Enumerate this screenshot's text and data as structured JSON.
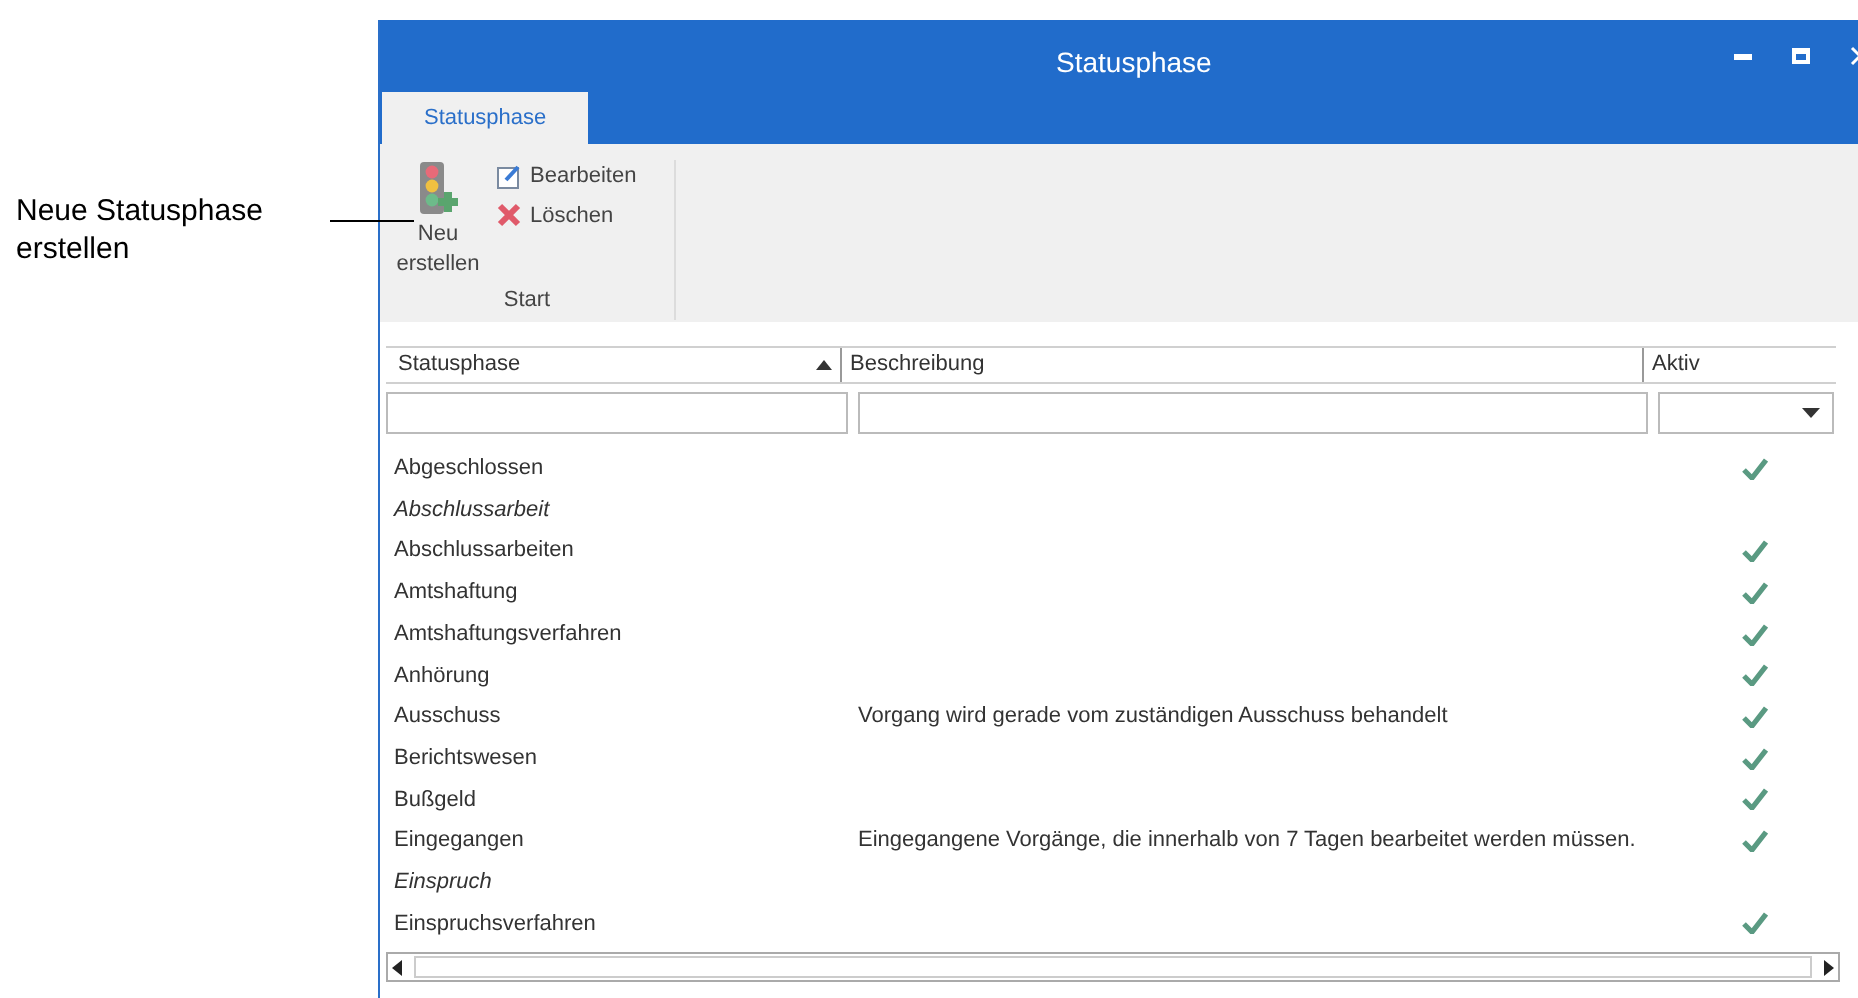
{
  "annotation": {
    "text": "Neue Statusphase erstellen"
  },
  "window": {
    "title": "Statusphase"
  },
  "tabs": [
    {
      "label": "Statusphase",
      "selected": true
    }
  ],
  "ribbon": {
    "new_button": "Neu erstellen",
    "edit_button": "Bearbeiten",
    "delete_button": "Löschen",
    "group_label": "Start"
  },
  "table": {
    "columns": [
      "Statusphase",
      "Beschreibung",
      "Aktiv"
    ],
    "rows": [
      {
        "name": "Abgeschlossen",
        "description": "",
        "active": true
      },
      {
        "name": "Abschlussarbeit",
        "description": "",
        "active": false
      },
      {
        "name": "Abschlussarbeiten",
        "description": "",
        "active": true
      },
      {
        "name": "Amtshaftung",
        "description": "",
        "active": true
      },
      {
        "name": "Amtshaftungsverfahren",
        "description": "",
        "active": true
      },
      {
        "name": "Anhörung",
        "description": "",
        "active": true
      },
      {
        "name": "Ausschuss",
        "description": "Vorgang wird gerade vom zuständigen Ausschuss behandelt",
        "active": true
      },
      {
        "name": "Berichtswesen",
        "description": "",
        "active": true
      },
      {
        "name": "Bußgeld",
        "description": "",
        "active": true
      },
      {
        "name": "Eingegangen",
        "description": "Eingegangene Vorgänge, die innerhalb von 7 Tagen bearbeitet werden müssen.",
        "active": true
      },
      {
        "name": "Einspruch",
        "description": "",
        "active": false
      },
      {
        "name": "Einspruchsverfahren",
        "description": "",
        "active": true
      }
    ]
  }
}
